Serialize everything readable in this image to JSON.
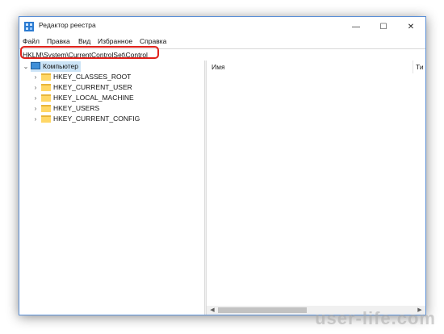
{
  "window": {
    "title": "Редактор реестра",
    "controls": {
      "minimize": "—",
      "maximize": "☐",
      "close": "✕"
    }
  },
  "menu": [
    "Файл",
    "Правка",
    "Вид",
    "Избранное",
    "Справка"
  ],
  "address": {
    "value": "HKLM\\System\\CurrentControlSet\\Control"
  },
  "tree": {
    "root": "Компьютер",
    "items": [
      "HKEY_CLASSES_ROOT",
      "HKEY_CURRENT_USER",
      "HKEY_LOCAL_MACHINE",
      "HKEY_USERS",
      "HKEY_CURRENT_CONFIG"
    ]
  },
  "list": {
    "columns": [
      "Имя",
      "Ти"
    ]
  },
  "watermark": "user-life.com",
  "colors": {
    "highlight": "#e0211b",
    "selection": "#cce4f7",
    "folder": "#ffd766"
  }
}
